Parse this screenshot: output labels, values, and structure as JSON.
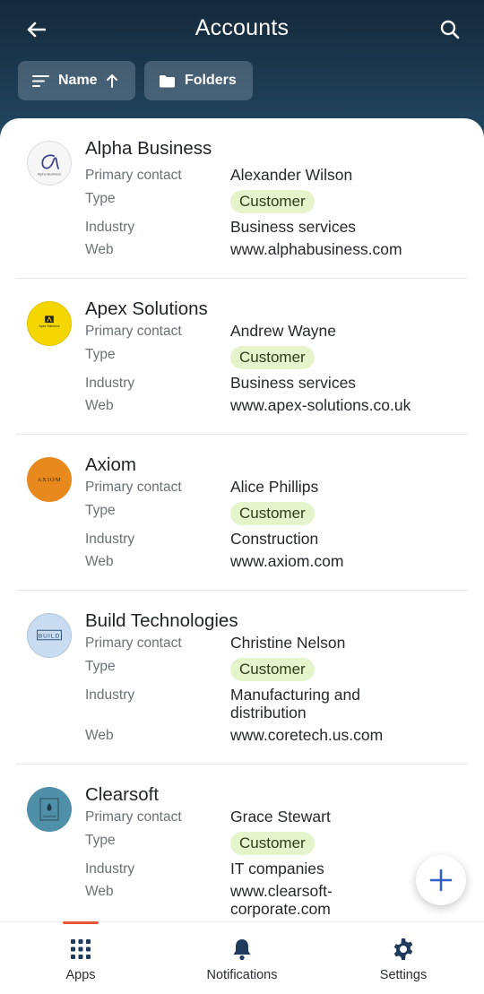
{
  "header": {
    "title": "Accounts",
    "sort_label": "Name",
    "folders_label": "Folders"
  },
  "icons": {
    "back": "arrow-left-icon",
    "search": "search-icon",
    "sort": "sort-lines-icon",
    "sort_direction": "arrow-up-icon",
    "folder": "folder-icon",
    "add": "plus-icon",
    "apps": "grid-icon",
    "notifications": "bell-icon",
    "settings": "gear-icon"
  },
  "labels": {
    "primary_contact": "Primary contact",
    "type": "Type",
    "industry": "Industry",
    "web": "Web"
  },
  "accounts": [
    {
      "name": "Alpha Business",
      "logo_text": "Alpha Business",
      "primary_contact": "Alexander Wilson",
      "type": "Customer",
      "industry": "Business services",
      "web": "www.alphabusiness.com"
    },
    {
      "name": "Apex Solutions",
      "logo_text": "Apex Solutions",
      "primary_contact": "Andrew Wayne",
      "type": "Customer",
      "industry": "Business services",
      "web": "www.apex-solutions.co.uk"
    },
    {
      "name": "Axiom",
      "logo_text": "AXIOM",
      "primary_contact": "Alice Phillips",
      "type": "Customer",
      "industry": "Construction",
      "web": "www.axiom.com"
    },
    {
      "name": "Build Technologies",
      "logo_text": "BUILD",
      "primary_contact": "Christine Nelson",
      "type": "Customer",
      "industry_line1": "Manufacturing and",
      "industry_line2": "distribution",
      "web": "www.coretech.us.com"
    },
    {
      "name": "Clearsoft",
      "logo_text": "ClearSoft",
      "primary_contact": "Grace Stewart",
      "type": "Customer",
      "industry": "IT companies",
      "web_line1": "www.clearsoft-",
      "web_line2": "corporate.com"
    }
  ],
  "nav": {
    "apps": "Apps",
    "notifications": "Notifications",
    "settings": "Settings"
  },
  "colors": {
    "header_bg": "#1d3b52",
    "badge_bg": "#e6f4cc",
    "accent": "#2f5fc4",
    "active_indicator": "#e8553c"
  }
}
